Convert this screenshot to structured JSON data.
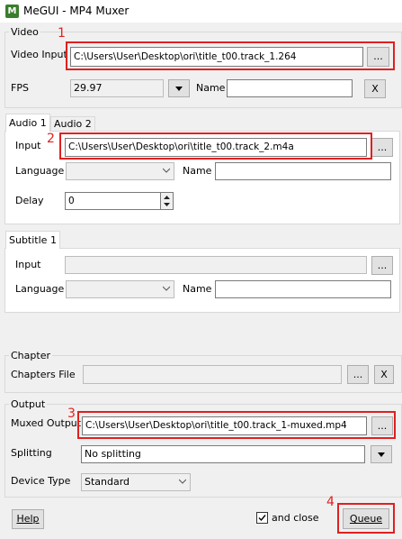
{
  "window": {
    "title": "MeGUI - MP4 Muxer",
    "icon": "megui-app-icon"
  },
  "video": {
    "group_label": "Video",
    "input_label": "Video Input",
    "input_value": "C:\\Users\\User\\Desktop\\ori\\title_t00.track_1.264",
    "browse": "...",
    "fps_label": "FPS",
    "fps_value": "29.97",
    "name_label": "Name",
    "name_value": "",
    "clear": "X"
  },
  "audio": {
    "tabs": [
      "Audio 1",
      "Audio 2"
    ],
    "input_label": "Input",
    "input_value": "C:\\Users\\User\\Desktop\\ori\\title_t00.track_2.m4a",
    "browse": "...",
    "language_label": "Language",
    "language_value": "",
    "name_label": "Name",
    "name_value": "",
    "delay_label": "Delay",
    "delay_value": "0"
  },
  "subtitle": {
    "tabs": [
      "Subtitle 1"
    ],
    "input_label": "Input",
    "input_value": "",
    "browse": "...",
    "language_label": "Language",
    "language_value": "",
    "name_label": "Name",
    "name_value": ""
  },
  "chapter": {
    "group_label": "Chapter",
    "file_label": "Chapters File",
    "file_value": "",
    "browse": "...",
    "clear": "X"
  },
  "output": {
    "group_label": "Output",
    "muxed_label": "Muxed Output",
    "muxed_value": "C:\\Users\\User\\Desktop\\ori\\title_t00.track_1-muxed.mp4",
    "browse": "...",
    "splitting_label": "Splitting",
    "splitting_value": "No splitting",
    "device_label": "Device Type",
    "device_value": "Standard"
  },
  "footer": {
    "help": "Help",
    "and_close": "and close",
    "and_close_checked": true,
    "queue": "Queue"
  },
  "annotations": [
    "1",
    "2",
    "3",
    "4"
  ],
  "colors": {
    "highlight": "#e02020",
    "titlebar": "#ffffff",
    "window_bg": "#f0f0f0"
  }
}
